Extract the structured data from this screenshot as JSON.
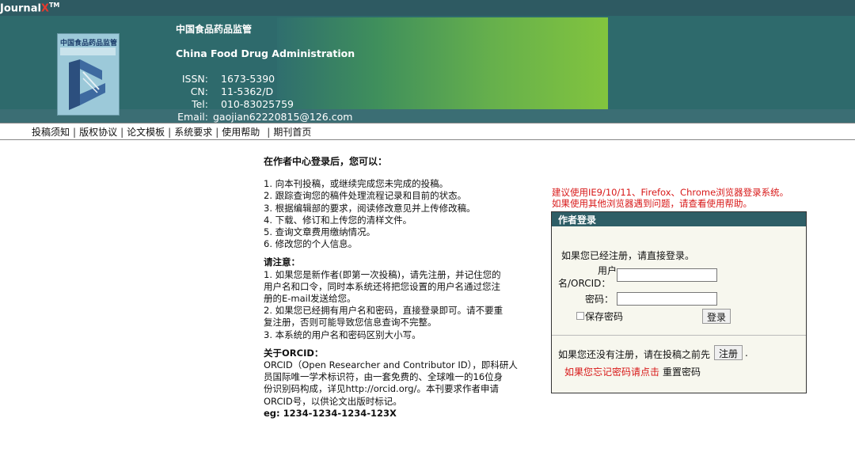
{
  "topbar": {
    "brand_prefix": "Journal",
    "brand_x": "X",
    "brand_tm": "TM"
  },
  "header": {
    "title_cn": "中国食品药品监管",
    "title_en": "China Food Drug Administration",
    "cover_title": "中国食品药品监管",
    "issn_label": "ISSN:",
    "issn_value": "1673-5390",
    "cn_label": "CN:",
    "cn_value": "11-5362/D",
    "tel_label": "Tel:",
    "tel_value": "010-83025759",
    "email_label": "Email:",
    "email_value": "gaojian62220815@126.com"
  },
  "nav": {
    "items": [
      "投稿须知",
      "版权协议",
      "论文模板",
      "系统要求",
      "使用帮助",
      "期刊首页"
    ],
    "separator": "|"
  },
  "main": {
    "heading": "在作者中心登录后，您可以：",
    "list": [
      "1. 向本刊投稿，或继续完成您未完成的投稿。",
      "2. 跟踪查询您的稿件处理流程记录和目前的状态。",
      "3. 根据编辑部的要求，阅读修改意见并上传修改稿。",
      "4. 下载、修订和上传您的清样文件。",
      "5. 查询文章费用缴纳情况。",
      "6. 修改您的个人信息。"
    ],
    "notice_title": "请注意：",
    "notice": [
      "1. 如果您是新作者(即第一次投稿)，请先注册，并记住您的",
      "用户名和口令，同时本系统还将把您设置的用户名通过您注",
      "册的E-mail发送给您。",
      "2. 如果您已经拥有用户名和密码，直接登录即可。请不要重",
      "复注册，否则可能导致您信息查询不完整。",
      "3. 本系统的用户名和密码区别大小写。"
    ],
    "orcid_title": "关于ORCID：",
    "orcid": [
      "ORCID（Open Researcher and Contributor ID），即科研人",
      "员国际唯一学术标识符，由一套免费的、全球唯一的16位身",
      "份识别码构成，详见http://orcid.org/。本刊要求作者申请",
      "ORCID号，以供论文出版时标记。"
    ],
    "orcid_example": "eg: 1234-1234-1234-123X"
  },
  "warning": {
    "line1": "建议使用IE9/10/11、Firefox、Chrome浏览器登录系统。",
    "line2": "如果使用其他浏览器遇到问题，请查看使用帮助。"
  },
  "login": {
    "title": "作者登录",
    "intro": "如果您已经注册，请直接登录。",
    "username_label_1": "用户",
    "username_label_2": "名/ORCID：",
    "password_label": "密码：",
    "username_value": "",
    "password_value": "",
    "remember_label": "保存密码",
    "login_button": "登录",
    "register_prompt": "如果您还没有注册，请在投稿之前先",
    "register_button": "注册",
    "register_suffix": ".",
    "forgot_text": "如果您忘记密码请点击",
    "reset_link": "重置密码"
  },
  "colors": {
    "header_bg": "#2e6a6c",
    "title_bar": "#2e5e66",
    "warning": "#d81818",
    "green_banner": "#82c43e"
  }
}
